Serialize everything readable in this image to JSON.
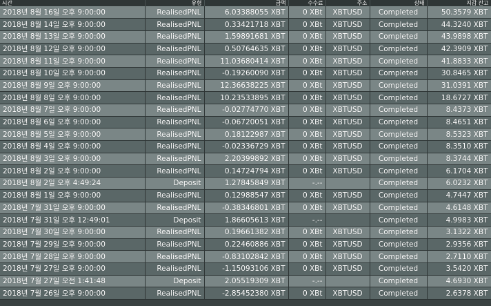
{
  "headers": {
    "time": "시간",
    "type": "유형",
    "amount": "금액",
    "fee": "수수료",
    "address": "주소",
    "status": "상태",
    "balance": "지갑 잔고"
  },
  "rows": [
    {
      "time": "2018년 8월 16일 오후 9:00:00",
      "type": "RealisedPNL",
      "amount": "6.03388055 XBT",
      "fee": "0 XBt",
      "address": "XBTUSD",
      "status": "Completed",
      "balance": "50.3579 XBT"
    },
    {
      "time": "2018년 8월 14일 오후 9:00:00",
      "type": "RealisedPNL",
      "amount": "0.33421718 XBT",
      "fee": "0 XBt",
      "address": "XBTUSD",
      "status": "Completed",
      "balance": "44.3240 XBT"
    },
    {
      "time": "2018년 8월 13일 오후 9:00:00",
      "type": "RealisedPNL",
      "amount": "1.59891681 XBT",
      "fee": "0 XBt",
      "address": "XBTUSD",
      "status": "Completed",
      "balance": "43.9898 XBT"
    },
    {
      "time": "2018년 8월 12일 오후 9:00:00",
      "type": "RealisedPNL",
      "amount": "0.50764635 XBT",
      "fee": "0 XBt",
      "address": "XBTUSD",
      "status": "Completed",
      "balance": "42.3909 XBT"
    },
    {
      "time": "2018년 8월 11일 오후 9:00:00",
      "type": "RealisedPNL",
      "amount": "11.03680414 XBT",
      "fee": "0 XBt",
      "address": "XBTUSD",
      "status": "Completed",
      "balance": "41.8833 XBT"
    },
    {
      "time": "2018년 8월 10일 오후 9:00:00",
      "type": "RealisedPNL",
      "amount": "-0.19260090 XBT",
      "fee": "0 XBt",
      "address": "XBTUSD",
      "status": "Completed",
      "balance": "30.8465 XBT"
    },
    {
      "time": "2018년 8월 9일 오후 9:00:00",
      "type": "RealisedPNL",
      "amount": "12.36638225 XBT",
      "fee": "0 XBt",
      "address": "XBTUSD",
      "status": "Completed",
      "balance": "31.0391 XBT"
    },
    {
      "time": "2018년 8월 8일 오후 9:00:00",
      "type": "RealisedPNL",
      "amount": "10.23533895 XBT",
      "fee": "0 XBt",
      "address": "XBTUSD",
      "status": "Completed",
      "balance": "18.6727 XBT"
    },
    {
      "time": "2018년 8월 7일 오후 9:00:00",
      "type": "RealisedPNL",
      "amount": "-0.02774770 XBT",
      "fee": "0 XBt",
      "address": "XBTUSD",
      "status": "Completed",
      "balance": "8.4373 XBT"
    },
    {
      "time": "2018년 8월 6일 오후 9:00:00",
      "type": "RealisedPNL",
      "amount": "-0.06720051 XBT",
      "fee": "0 XBt",
      "address": "XBTUSD",
      "status": "Completed",
      "balance": "8.4651 XBT"
    },
    {
      "time": "2018년 8월 5일 오후 9:00:00",
      "type": "RealisedPNL",
      "amount": "0.18122987 XBT",
      "fee": "0 XBt",
      "address": "XBTUSD",
      "status": "Completed",
      "balance": "8.5323 XBT"
    },
    {
      "time": "2018년 8월 4일 오후 9:00:00",
      "type": "RealisedPNL",
      "amount": "-0.02336729 XBT",
      "fee": "0 XBt",
      "address": "XBTUSD",
      "status": "Completed",
      "balance": "8.3510 XBT"
    },
    {
      "time": "2018년 8월 3일 오후 9:00:00",
      "type": "RealisedPNL",
      "amount": "2.20399892 XBT",
      "fee": "0 XBt",
      "address": "XBTUSD",
      "status": "Completed",
      "balance": "8.3744 XBT"
    },
    {
      "time": "2018년 8월 2일 오후 9:00:00",
      "type": "RealisedPNL",
      "amount": "0.14724794 XBT",
      "fee": "0 XBt",
      "address": "XBTUSD",
      "status": "Completed",
      "balance": "6.1704 XBT"
    },
    {
      "time": "2018년 8월 2일 오후 4:49:24",
      "type": "Deposit",
      "amount": "1.27845849 XBT",
      "fee": "-.--",
      "address": "",
      "status": "Completed",
      "balance": "6.0232 XBT"
    },
    {
      "time": "2018년 8월 1일 오후 9:00:00",
      "type": "RealisedPNL",
      "amount": "0.12988547 XBT",
      "fee": "0 XBt",
      "address": "XBTUSD",
      "status": "Completed",
      "balance": "4.7447 XBT"
    },
    {
      "time": "2018년 7월 31일 오후 9:00:00",
      "type": "RealisedPNL",
      "amount": "-0.38346801 XBT",
      "fee": "0 XBt",
      "address": "XBTUSD",
      "status": "Completed",
      "balance": "4.6148 XBT"
    },
    {
      "time": "2018년 7월 31일 오후 12:49:01",
      "type": "Deposit",
      "amount": "1.86605613 XBT",
      "fee": "-.--",
      "address": "",
      "status": "Completed",
      "balance": "4.9983 XBT"
    },
    {
      "time": "2018년 7월 30일 오후 9:00:00",
      "type": "RealisedPNL",
      "amount": "0.19661382 XBT",
      "fee": "0 XBt",
      "address": "XBTUSD",
      "status": "Completed",
      "balance": "3.1322 XBT"
    },
    {
      "time": "2018년 7월 29일 오후 9:00:00",
      "type": "RealisedPNL",
      "amount": "0.22460886 XBT",
      "fee": "0 XBt",
      "address": "XBTUSD",
      "status": "Completed",
      "balance": "2.9356 XBT"
    },
    {
      "time": "2018년 7월 28일 오후 9:00:00",
      "type": "RealisedPNL",
      "amount": "-0.83102842 XBT",
      "fee": "0 XBt",
      "address": "XBTUSD",
      "status": "Completed",
      "balance": "2.7110 XBT"
    },
    {
      "time": "2018년 7월 27일 오후 9:00:00",
      "type": "RealisedPNL",
      "amount": "-1.15093106 XBT",
      "fee": "0 XBt",
      "address": "XBTUSD",
      "status": "Completed",
      "balance": "3.5420 XBT"
    },
    {
      "time": "2018년 7월 27일 오전 1:41:48",
      "type": "Deposit",
      "amount": "2.05519309 XBT",
      "fee": "-.--",
      "address": "",
      "status": "Completed",
      "balance": "4.6930 XBT"
    },
    {
      "time": "2018년 7월 26일 오후 9:00:00",
      "type": "RealisedPNL",
      "amount": "-2.85452380 XBT",
      "fee": "0 XBt",
      "address": "XBTUSD",
      "status": "Completed",
      "balance": "2.6378 XBT"
    }
  ]
}
